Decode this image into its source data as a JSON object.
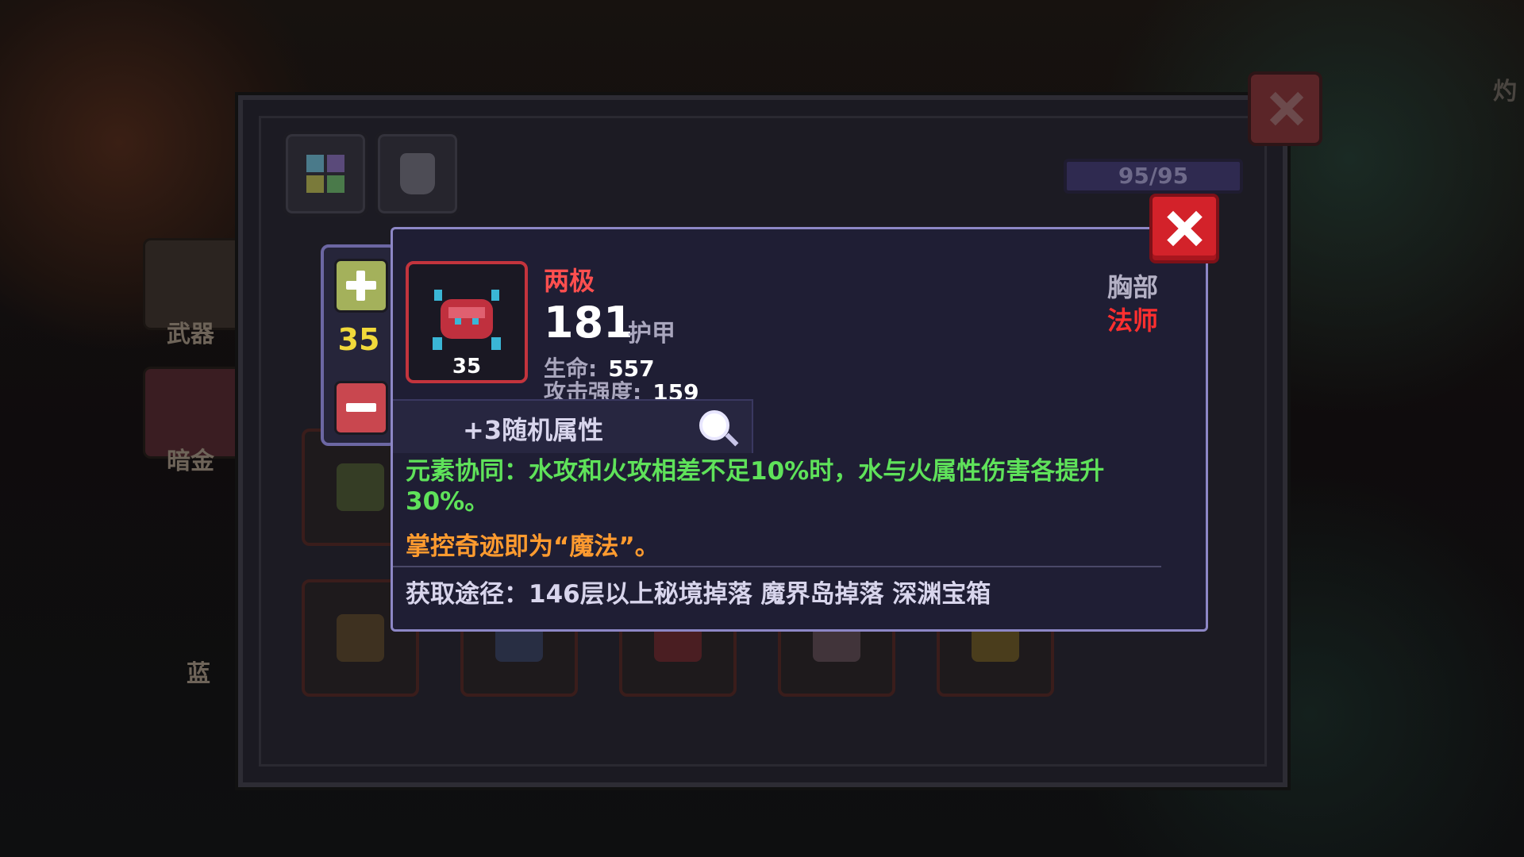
{
  "background": {
    "side_tabs": [
      {
        "label": "武器"
      },
      {
        "label": "暗金"
      },
      {
        "label": "蓝"
      }
    ],
    "right_edge_text": "灼"
  },
  "inventory": {
    "capacity": "95/95",
    "tabs": [
      {
        "name": "grid-category-icon"
      },
      {
        "name": "armor-category-icon"
      }
    ]
  },
  "level_stepper": {
    "value": "35"
  },
  "item_popup": {
    "name": "两极",
    "level": "35",
    "armor_value": "181",
    "armor_label": "护甲",
    "stats": [
      {
        "key": "生命:",
        "value": "557"
      },
      {
        "key": "攻击强度:",
        "value": "159"
      }
    ],
    "slot_type": "胸部",
    "class_requirement": "法师",
    "random_attributes": "+3随机属性",
    "effect": "元素协同：水攻和火攻相差不足10%时，水与火属性伤害各提升30%。",
    "flavor": "掌控奇迹即为“魔法”。",
    "source": "获取途径：146层以上秘境掉落 魔界岛掉落 深渊宝箱"
  },
  "colors": {
    "item_name": "#ff4f4f",
    "effect_text": "#5fe25a",
    "flavor_text": "#ff9b2f",
    "class_requirement": "#ff2f2f",
    "level_value": "#f1d93a"
  }
}
